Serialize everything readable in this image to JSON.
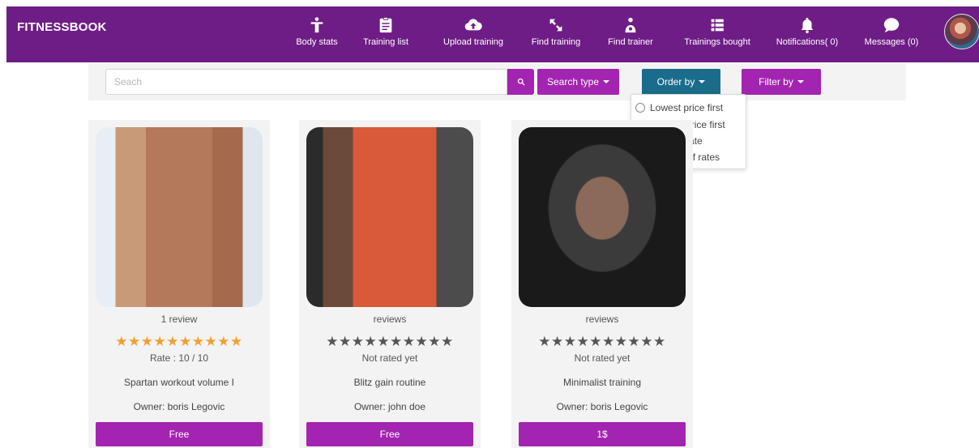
{
  "app": {
    "brand": "FITNESSBOOK"
  },
  "nav": {
    "items": [
      {
        "label": "Body stats",
        "icon": "person-icon"
      },
      {
        "label": "Training list",
        "icon": "clipboard-icon"
      },
      {
        "label": "Upload training",
        "icon": "cloud-upload-icon"
      },
      {
        "label": "Find training",
        "icon": "expand-icon"
      },
      {
        "label": "Find trainer",
        "icon": "trainer-icon"
      },
      {
        "label": "Trainings bought",
        "icon": "list-icon"
      },
      {
        "label": "Notifications( 0)",
        "icon": "bell-icon"
      },
      {
        "label": "Messages (0)",
        "icon": "chat-bubble-icon"
      }
    ]
  },
  "search": {
    "placeholder": "Seach",
    "search_type_label": "Search type",
    "order_by_label": "Order by",
    "filter_by_label": "Filter by"
  },
  "order_dropdown": {
    "options": [
      "Lowest price first",
      "Highest price first",
      "Highest rate",
      "Number of rates"
    ]
  },
  "colors": {
    "nav_bg": "#6f1d86",
    "accent": "#a324b0",
    "order_btn": "#1a6c8a",
    "star_rated": "#f0a030",
    "star_unrated": "#555555"
  },
  "cards": [
    {
      "reviews": "1 review",
      "stars": "★★★★★★★★★★",
      "rated": true,
      "rate_text": "Rate : 10 / 10",
      "title": "Spartan workout volume I",
      "owner": "Owner: boris Legovic",
      "price": "Free"
    },
    {
      "reviews": "reviews",
      "stars": "★★★★★★★★★★",
      "rated": false,
      "rate_text": "Not rated yet",
      "title": "Blitz gain routine",
      "owner": "Owner: john doe",
      "price": "Free"
    },
    {
      "reviews": "reviews",
      "stars": "★★★★★★★★★★",
      "rated": false,
      "rate_text": "Not rated yet",
      "title": "Minimalist training",
      "owner": "Owner: boris Legovic",
      "price": "1$"
    }
  ]
}
